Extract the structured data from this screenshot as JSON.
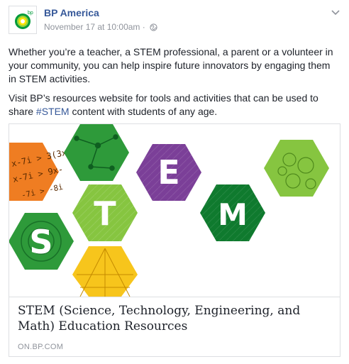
{
  "post": {
    "page_name": "BP America",
    "date": "November 17 at 10:00am",
    "separator": "·",
    "avatar_label": "bp",
    "paragraph1": "Whether you’re a teacher, a STEM professional, a parent or a volunteer in your community, you can help inspire future innovators by engaging them in STEM activities.",
    "paragraph2_before": "Visit BP’s resources website for tools and activities that can be used to share ",
    "hashtag": "#STEM",
    "paragraph2_after": " content with students of any age."
  },
  "card": {
    "image_letters": [
      "S",
      "T",
      "E",
      "M"
    ],
    "math_notes": [
      "x-7i > 3(3x",
      "x-7i > 9x-",
      "-7i > -8i"
    ],
    "title": "STEM (Science, Technology, Engineering, and Math) Education Resources",
    "domain": "ON.BP.COM"
  },
  "colors": {
    "link": "#365899",
    "orange": "#ef7d22",
    "green": "#2e9a3a",
    "dark_green": "#0f7a2e",
    "lime": "#86c540",
    "purple": "#7b3f98",
    "yellow": "#f7c51c",
    "bp_green": "#009b3a",
    "bp_yellow": "#ffe600"
  }
}
